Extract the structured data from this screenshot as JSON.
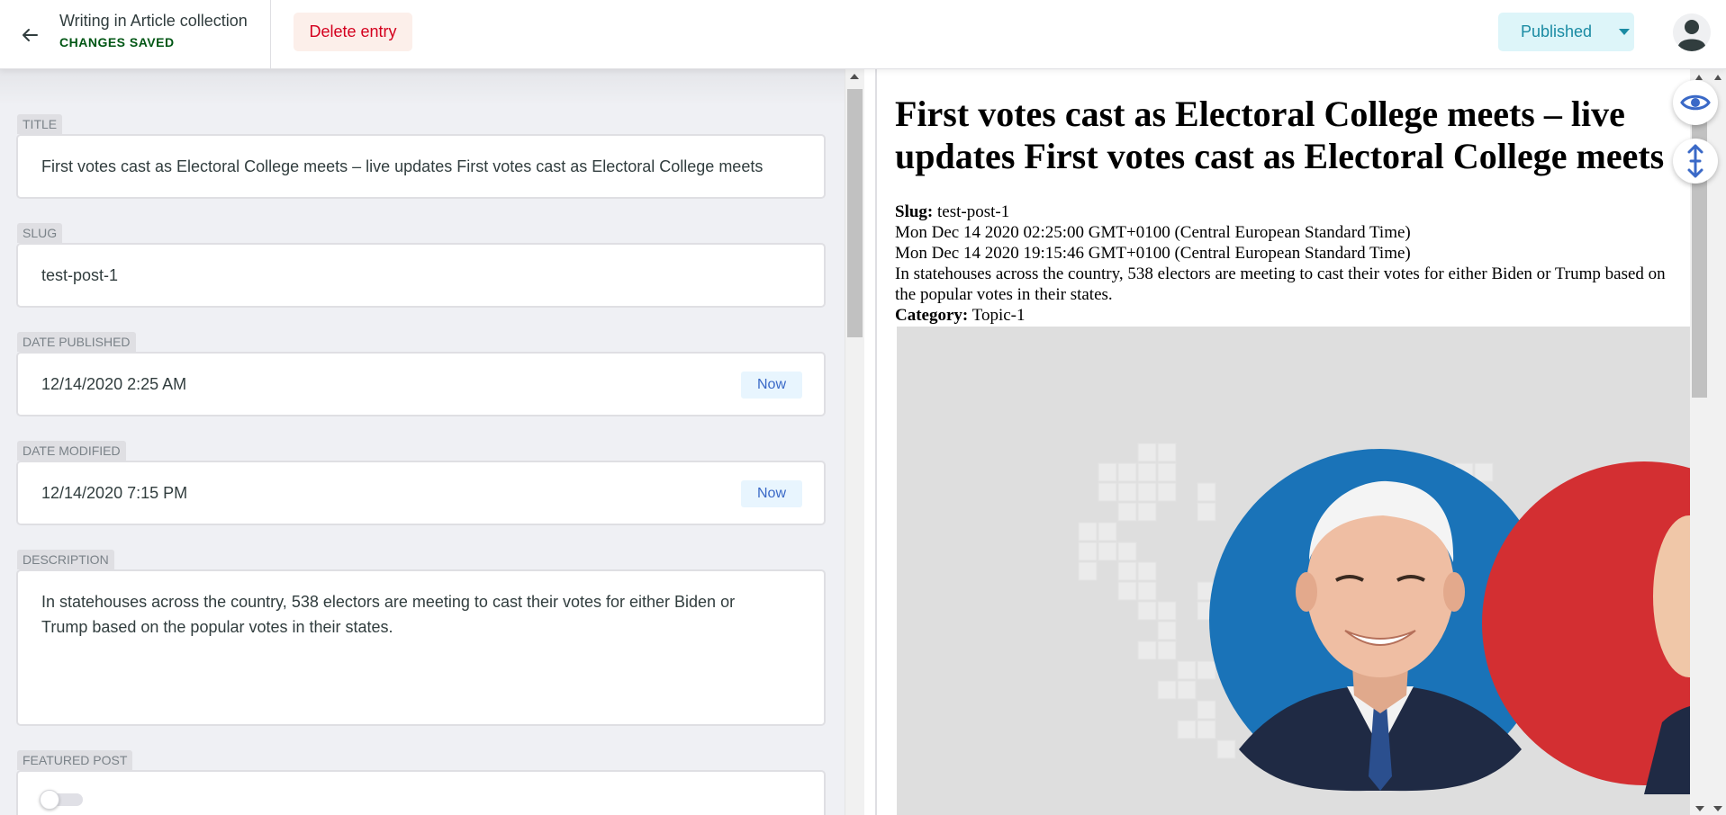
{
  "header": {
    "collection_title": "Writing in Article collection",
    "save_status": "CHANGES SAVED",
    "delete_label": "Delete entry",
    "publish_status": "Published",
    "back_icon": "arrow-left-icon",
    "avatar_icon": "user-avatar-icon"
  },
  "editor": {
    "fields": {
      "title": {
        "label": "TITLE",
        "value": "First votes cast as Electoral College meets – live updates First votes cast as Electoral College meets"
      },
      "slug": {
        "label": "SLUG",
        "value": "test-post-1"
      },
      "date_published": {
        "label": "DATE PUBLISHED",
        "value": "12/14/2020 2:25 AM",
        "now_label": "Now"
      },
      "date_modified": {
        "label": "DATE MODIFIED",
        "value": "12/14/2020 7:15 PM",
        "now_label": "Now"
      },
      "description": {
        "label": "DESCRIPTION",
        "value": "In statehouses across the country, 538 electors are meeting to cast their votes for either Biden or Trump based on the popular votes in their states."
      },
      "featured_post": {
        "label": "FEATURED POST",
        "value": false
      }
    }
  },
  "preview": {
    "title": "First votes cast as Electoral College meets – live updates First votes cast as Electoral College meets",
    "slug_label": "Slug:",
    "slug_value": "test-post-1",
    "date_published": "Mon Dec 14 2020 02:25:00 GMT+0100 (Central European Standard Time)",
    "date_modified": "Mon Dec 14 2020 19:15:46 GMT+0100 (Central European Standard Time)",
    "description": "In statehouses across the country, 538 electors are meeting to cast their votes for either Biden or Trump based on the popular votes in their states.",
    "category_label": "Category:",
    "category_value": "Topic-1",
    "image_icon": "featured-image"
  },
  "floating_buttons": {
    "preview_toggle_icon": "eye-icon",
    "sync_scroll_icon": "sync-scroll-icon"
  },
  "colors": {
    "accent_green": "#005614",
    "delete_red": "#d4001e",
    "publish_teal": "#1a8ba3",
    "candidate_blue": "#1a73b8",
    "candidate_red": "#d32f32"
  }
}
